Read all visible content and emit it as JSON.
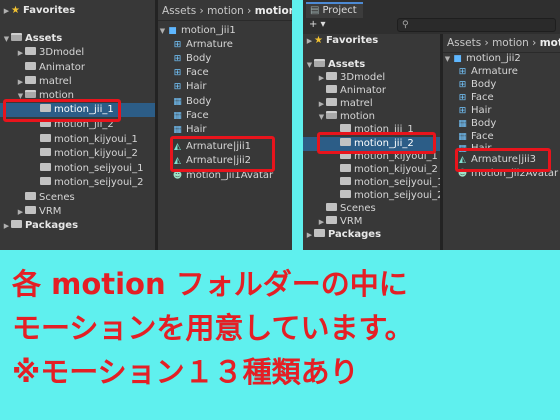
{
  "left_panel": {
    "favorites_label": "Favorites",
    "assets_label": "Assets",
    "tree": [
      "3Dmodel",
      "Animator",
      "matrel",
      "motion",
      "motion_jii_1",
      "motion_jii_2",
      "motion_kijyoui_1",
      "motion_kijyoui_2",
      "motion_seijyoui_1",
      "motion_seijyoui_2",
      "Scenes",
      "VRM"
    ],
    "packages_label": "Packages",
    "breadcrumb": {
      "root": "Assets",
      "mid": "motion",
      "last": "motion"
    },
    "files": [
      "motion_jii1",
      "Armature",
      "Body",
      "Face",
      "Hair",
      "Body",
      "Face",
      "Hair",
      "Armature|jii1",
      "Armature|jii2",
      "motion_jii1Avatar"
    ]
  },
  "right_panel": {
    "tab_label": "Project",
    "add_label": "+ ▾",
    "favorites_label": "Favorites",
    "assets_label": "Assets",
    "tree": [
      "3Dmodel",
      "Animator",
      "matrel",
      "motion",
      "motion_jii_1",
      "motion_jii_2",
      "motion_kijyoui_1",
      "motion_kijyoui_2",
      "motion_seijyoui_1",
      "motion_seijyoui_2",
      "Scenes",
      "VRM"
    ],
    "packages_label": "Packages",
    "breadcrumb": {
      "root": "Assets",
      "mid": "motion",
      "last": "motio"
    },
    "files": [
      "motion_jii2",
      "Armature",
      "Body",
      "Face",
      "Hair",
      "Body",
      "Face",
      "Hair",
      "Armature|jii3",
      "motion_jii2Avatar"
    ]
  },
  "caption": {
    "line1": "各 motion フォルダーの中に",
    "line2": "モーションを用意しています。",
    "line3": "※モーション１３種類あり"
  },
  "colors": {
    "background": "#5ff0ee",
    "caption": "#e41f25",
    "highlight": "#e8141c",
    "selected": "#2c5d87"
  }
}
